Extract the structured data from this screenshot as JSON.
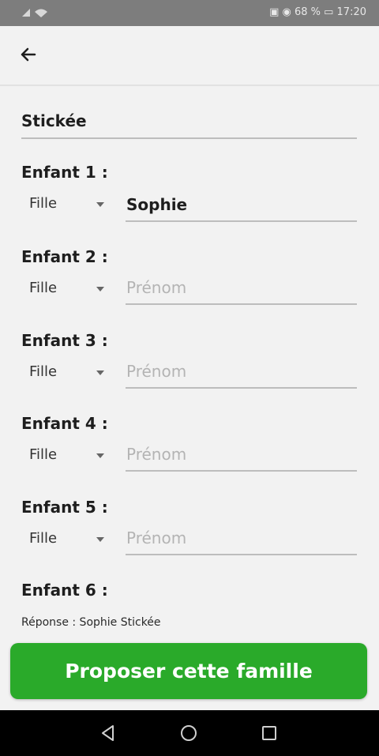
{
  "status_bar": {
    "left_icons": "signal-icon wifi-icon",
    "right_text": "▣ ◉ 68 % ▭ 17:20"
  },
  "family_name": "Stickée",
  "children": [
    {
      "label": "Enfant 1 :",
      "gender": "Fille",
      "name_value": "Sophie",
      "name_placeholder": ""
    },
    {
      "label": "Enfant 2 :",
      "gender": "Fille",
      "name_value": "",
      "name_placeholder": "Prénom"
    },
    {
      "label": "Enfant 3 :",
      "gender": "Fille",
      "name_value": "",
      "name_placeholder": "Prénom"
    },
    {
      "label": "Enfant 4 :",
      "gender": "Fille",
      "name_value": "",
      "name_placeholder": "Prénom"
    },
    {
      "label": "Enfant 5 :",
      "gender": "Fille",
      "name_value": "",
      "name_placeholder": "Prénom"
    },
    {
      "label": "Enfant 6 :"
    }
  ],
  "answer_text": "Réponse : Sophie Stickée",
  "submit_label": "Proposer cette famille",
  "colors": {
    "accent": "#2aaa2a",
    "background": "#f2f2f2",
    "nav_bar": "#000000"
  },
  "icons": {
    "back": "arrow-left-icon",
    "nav": [
      "back-triangle-icon",
      "home-circle-icon",
      "recents-square-icon"
    ]
  }
}
